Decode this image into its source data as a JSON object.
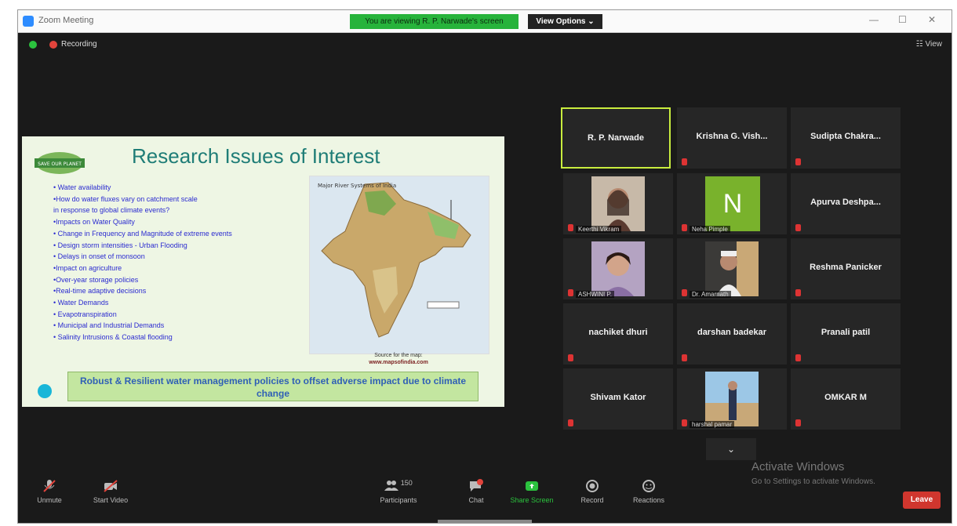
{
  "window": {
    "title": "Zoom Meeting",
    "share_banner": "You are viewing R. P. Narwade's screen",
    "view_options": "View Options ⌄",
    "minimize": "—",
    "maximize": "☐",
    "close": "✕"
  },
  "topbar": {
    "recording_label": "Recording",
    "view_label": "☷ View"
  },
  "slide": {
    "title": "Research Issues of Interest",
    "logo_text": "SAVE OUR PLANET",
    "bullets": [
      "• Water availability",
      "      •How do water fluxes vary on catchment scale",
      "in response to global climate events?",
      "      •Impacts on Water Quality",
      "•     Change in Frequency and Magnitude of  extreme events",
      "• Design storm intensities - Urban Flooding",
      "• Delays in onset of monsoon",
      "      •Impact on agriculture",
      "      •Over-year storage policies",
      "      •Real-time adaptive decisions",
      "• Water Demands",
      "      •  Evapotranspiration",
      "      •  Municipal and Industrial Demands",
      "• Salinity Intrusions & Coastal flooding"
    ],
    "map_title": "Major River Systems of India",
    "map_source": "Source for the map:",
    "map_url": "www.mapsofindia.com",
    "footer": "Robust & Resilient water management policies  to offset adverse impact due to climate change"
  },
  "participants": [
    {
      "name": "R. P. Narwade",
      "type": "name",
      "active": true
    },
    {
      "name": "Krishna G. Vish...",
      "type": "name"
    },
    {
      "name": "Sudipta  Chakra...",
      "type": "name"
    },
    {
      "name": "Keerthi Vikram",
      "type": "photo"
    },
    {
      "name": "Neha Pimple",
      "type": "avatar",
      "initial": "N"
    },
    {
      "name": "Apurva  Deshpa...",
      "type": "name"
    },
    {
      "name": "ASHWINI P.",
      "type": "photo"
    },
    {
      "name": "Dr. Amarnath",
      "type": "photo"
    },
    {
      "name": "Reshma Panicker",
      "type": "name"
    },
    {
      "name": "nachiket dhuri",
      "type": "name"
    },
    {
      "name": "darshan badekar",
      "type": "name"
    },
    {
      "name": "Pranali patil",
      "type": "name"
    },
    {
      "name": "Shivam Kator",
      "type": "name"
    },
    {
      "name": "harshal pamar",
      "type": "photo"
    },
    {
      "name": "OMKAR M",
      "type": "name"
    }
  ],
  "watermark": {
    "line1": "Activate Windows",
    "line2": "Go to Settings to activate Windows."
  },
  "toolbar": {
    "unmute": "Unmute",
    "start_video": "Start Video",
    "participants": "Participants",
    "participants_count": "150",
    "chat": "Chat",
    "share_screen": "Share Screen",
    "record": "Record",
    "reactions": "Reactions",
    "leave": "Leave"
  },
  "colors": {
    "share_banner": "#27b33b",
    "active_speaker": "#c9ed3e",
    "leave": "#d0362e",
    "slide_title": "#1f7d77",
    "bullets": "#2b2bd0"
  }
}
